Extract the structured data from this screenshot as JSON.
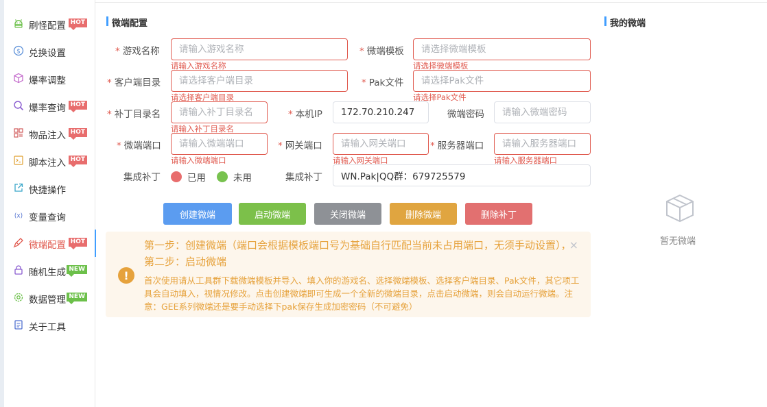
{
  "sidebar": {
    "items": [
      {
        "label": "刷怪配置",
        "icon": "android-icon",
        "badge": "HOT"
      },
      {
        "label": "兑换设置",
        "icon": "exchange-icon",
        "badge": ""
      },
      {
        "label": "爆率调整",
        "icon": "box-icon",
        "badge": ""
      },
      {
        "label": "爆率查询",
        "icon": "search-icon",
        "badge": "HOT"
      },
      {
        "label": "物品注入",
        "icon": "grid-icon",
        "badge": "HOT"
      },
      {
        "label": "脚本注入",
        "icon": "script-icon",
        "badge": "HOT"
      },
      {
        "label": "快捷操作",
        "icon": "external-link-icon",
        "badge": ""
      },
      {
        "label": "变量查询",
        "icon": "variable-icon",
        "badge": ""
      },
      {
        "label": "微端配置",
        "icon": "brush-icon",
        "badge": "HOT"
      },
      {
        "label": "随机生成",
        "icon": "lock-icon",
        "badge": "NEW"
      },
      {
        "label": "数据管理",
        "icon": "settings-icon",
        "badge": "NEW"
      },
      {
        "label": "关于工具",
        "icon": "document-icon",
        "badge": ""
      }
    ],
    "active_index": 8
  },
  "form": {
    "section_title": "微端配置",
    "game_name": {
      "label": "游戏名称",
      "placeholder": "请输入游戏名称",
      "error": "请输入游戏名称"
    },
    "template": {
      "label": "微端模板",
      "placeholder": "请选择微端模板",
      "error": "请选择微端模板"
    },
    "client_dir": {
      "label": "客户端目录",
      "placeholder": "请选择客户端目录",
      "error": "请选择客户端目录"
    },
    "pak_file": {
      "label": "Pak文件",
      "placeholder": "请选择Pak文件",
      "error": "请选择Pak文件"
    },
    "patch_dir": {
      "label": "补丁目录名",
      "placeholder": "请输入补丁目录名",
      "error": "请输入补丁目录名"
    },
    "local_ip": {
      "label": "本机IP",
      "value": "172.70.210.247"
    },
    "password": {
      "label": "微端密码",
      "placeholder": "请输入微端密码"
    },
    "port": {
      "label": "微端端口",
      "placeholder": "请输入微端端口",
      "error": "请输入微端端口"
    },
    "gateway_port": {
      "label": "网关端口",
      "placeholder": "请输入网关端口",
      "error": "请输入网关端口"
    },
    "server_port": {
      "label": "服务器端口",
      "placeholder": "请输入服务器端口",
      "error": "请输入服务器端口"
    },
    "integrate_patch": {
      "label": "集成补丁",
      "options": [
        "已用",
        "未用"
      ]
    },
    "integrate_patch2": {
      "label": "集成补丁",
      "value": "WN.Pak|QQ群：679725579"
    }
  },
  "buttons": {
    "create": "创建微端",
    "start": "启动微端",
    "stop": "关闭微端",
    "delete": "删除微端",
    "delete_patch": "删除补丁"
  },
  "alert": {
    "title": "第一步：创建微端（端口会根据模板端口号为基础自行匹配当前未占用端口，无须手动设置），第二步：启动微端",
    "description": "首次使用请从工具群下载微端模板并导入、填入你的游戏名、选择微端模板、选择客户端目录、Pak文件，其它项工具会自动填入，视情况修改。点击创建微端即可生成一个全新的微端目录，点击启动微端，则会自动运行微端。注意：GEE系列微端还是要手动选择下pak保存生成加密密码（不可避免）"
  },
  "right_panel": {
    "title": "我的微端",
    "empty_text": "暂无微端"
  }
}
